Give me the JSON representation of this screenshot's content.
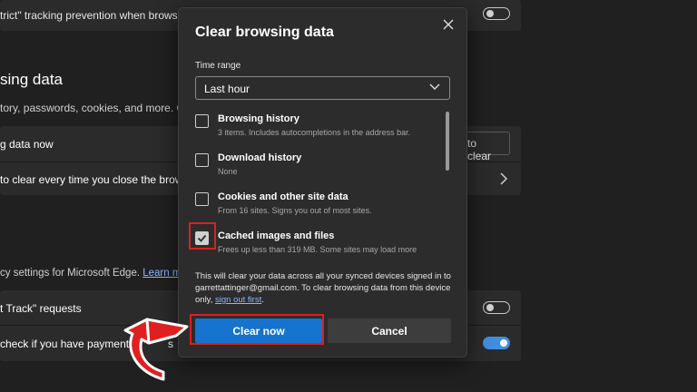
{
  "background": {
    "tracking_row_text": "trict\" tracking prevention when browsi",
    "section_title": "sing data",
    "section_desc": "tory, passwords, cookies, and more. Only",
    "clear_now_row": "g data now",
    "clear_button_partial": "to clear",
    "clear_every_row": "to clear every time you close the brows",
    "privacy_text": "cy settings for Microsoft Edge.",
    "privacy_link": "Learn mo",
    "dnt_row": "t Track\" requests",
    "payment_row": "check if you have payment",
    "payment_row_tail": "s"
  },
  "dialog": {
    "title": "Clear browsing data",
    "time_range_label": "Time range",
    "time_range_value": "Last hour",
    "options": [
      {
        "title": "Browsing history",
        "desc": "3 items. Includes autocompletions in the address bar.",
        "checked": false
      },
      {
        "title": "Download history",
        "desc": "None",
        "checked": false
      },
      {
        "title": "Cookies and other site data",
        "desc": "From 16 sites. Signs you out of most sites.",
        "checked": false
      },
      {
        "title": "Cached images and files",
        "desc": "Frees up less than 319 MB. Some sites may load more",
        "checked": true
      }
    ],
    "info_text": "This will clear your data across all your synced devices signed in to garrettattinger@gmail.com. To clear browsing data from this device only,",
    "info_link": "sign out first",
    "info_end": ".",
    "clear_button": "Clear now",
    "cancel_button": "Cancel"
  },
  "colors": {
    "accent": "#1673cf",
    "highlight": "#e01e1e",
    "toggle_on": "#3f8ee0"
  },
  "icons": [
    "close-icon",
    "chevron-down-icon",
    "checkmark-icon",
    "chevron-right-icon",
    "curved-arrow-icon"
  ]
}
